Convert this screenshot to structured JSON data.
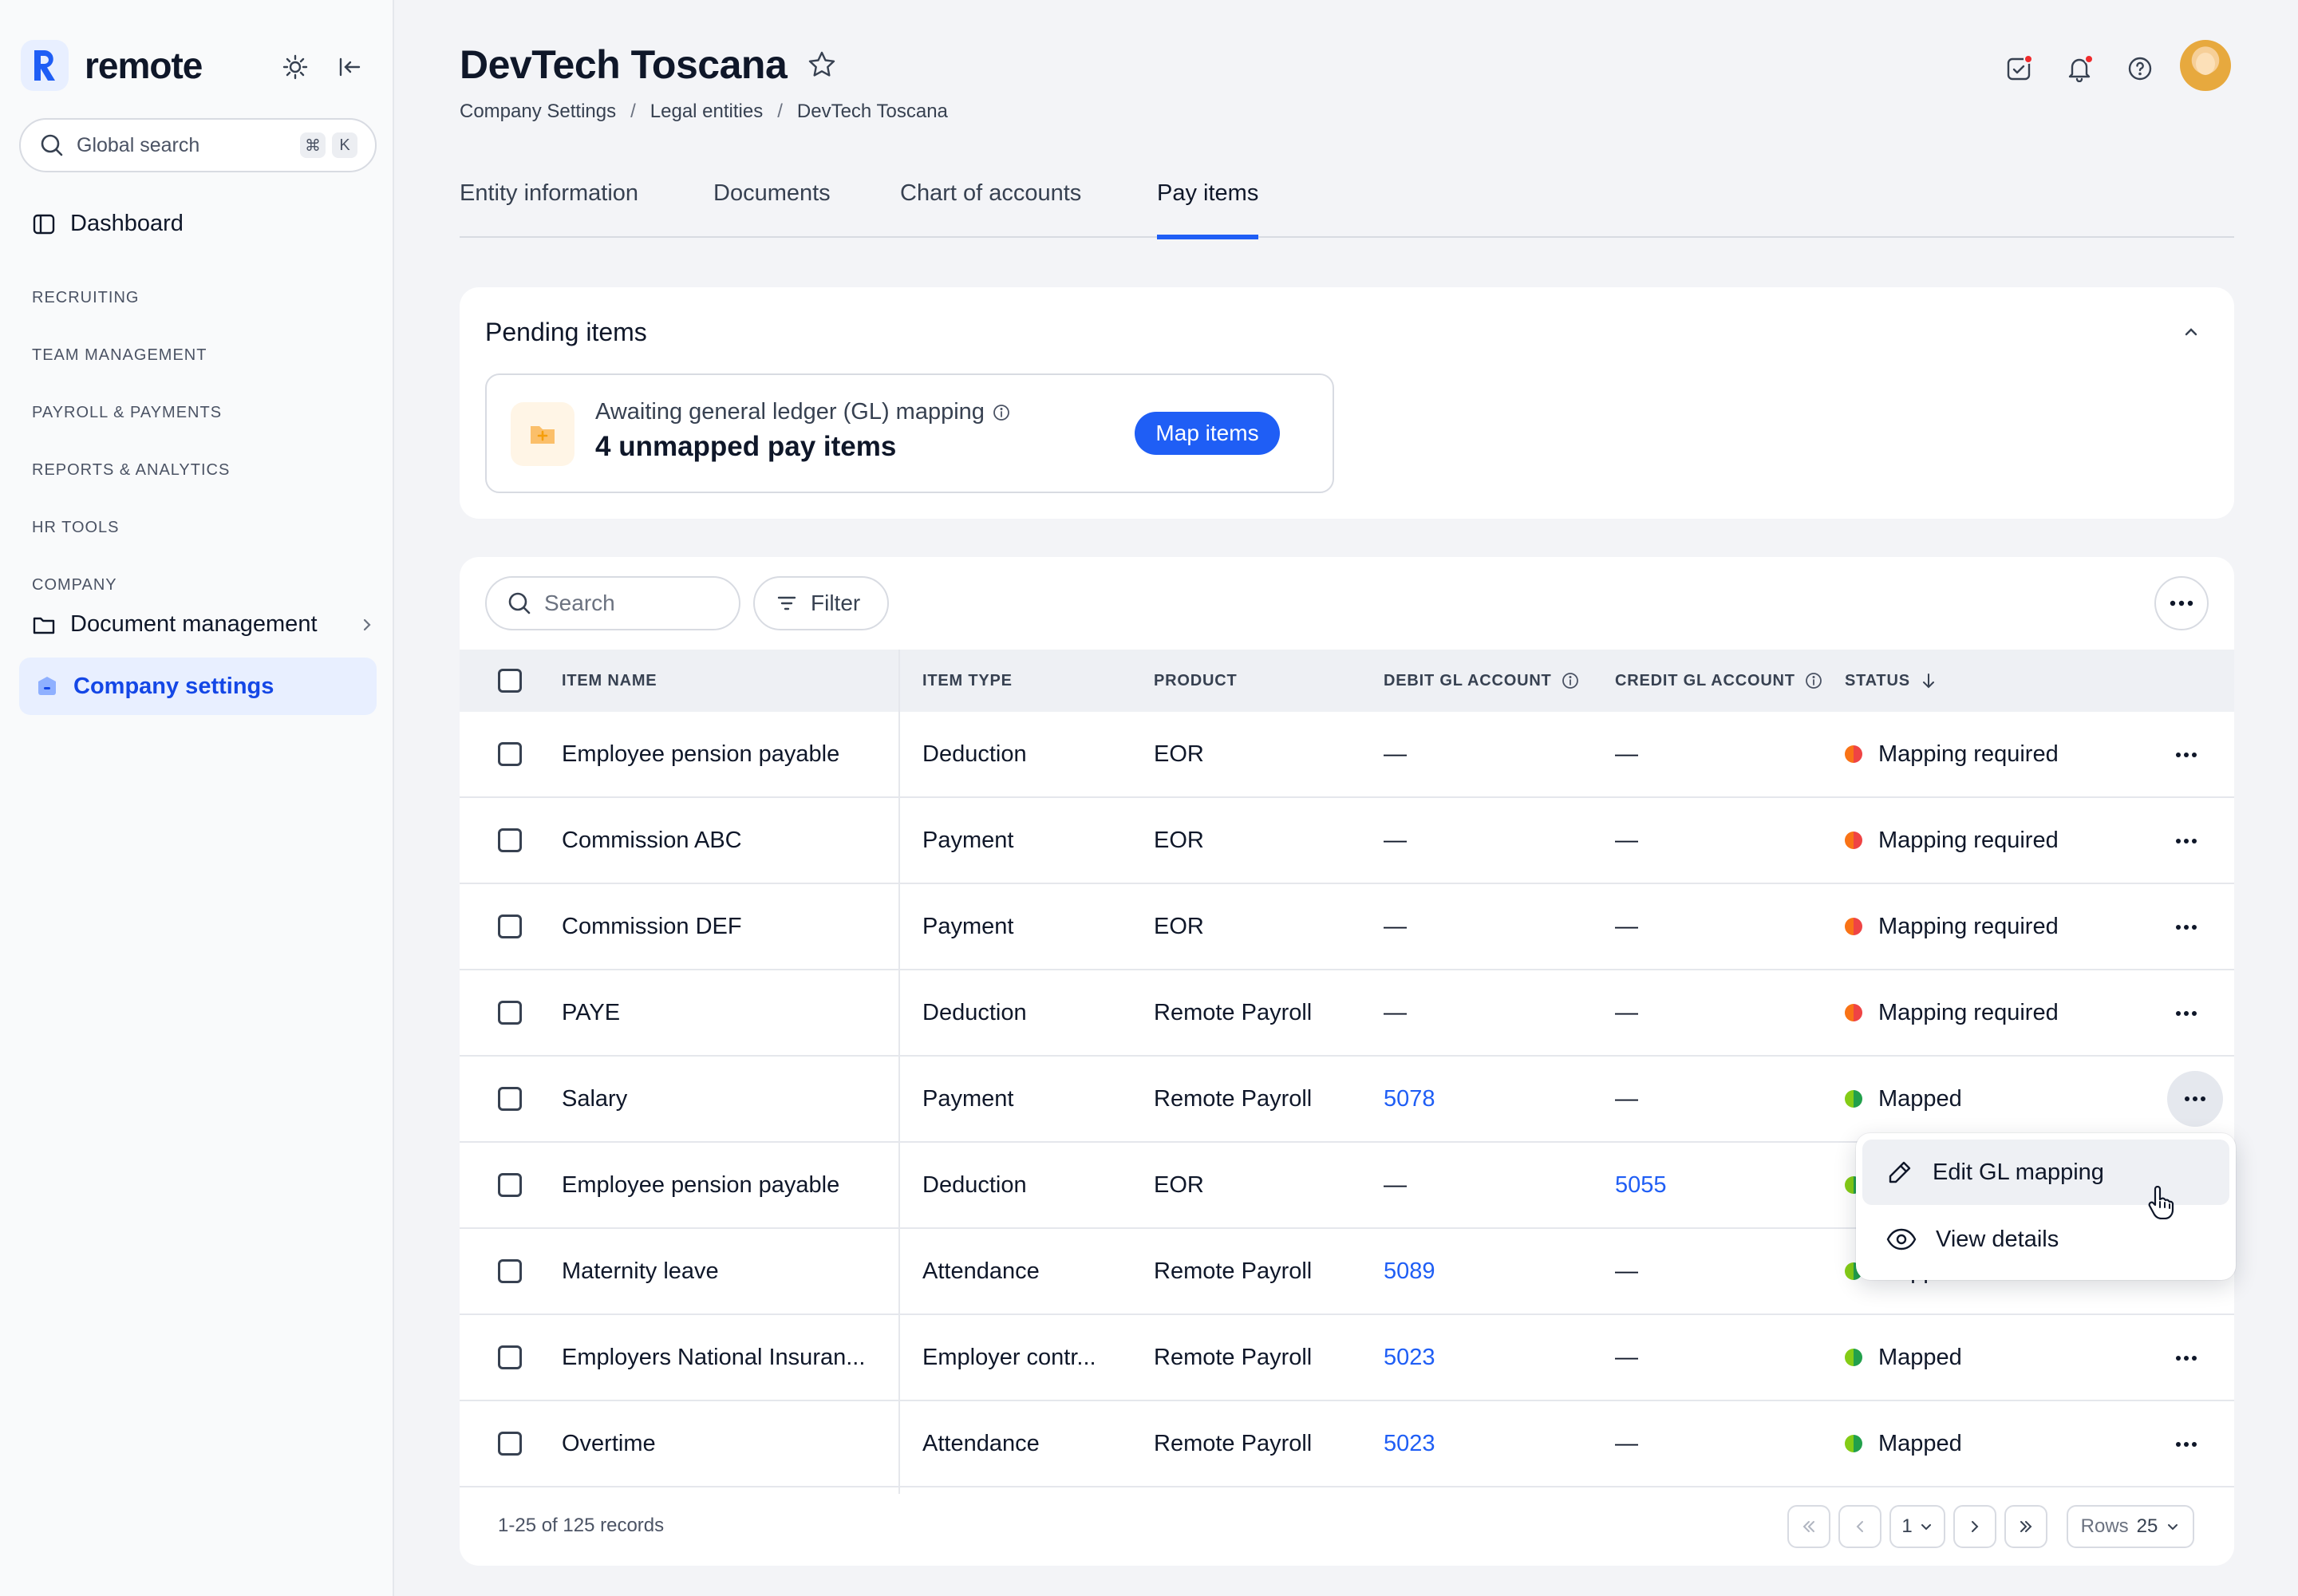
{
  "sidebar": {
    "logo": "remote",
    "search_placeholder": "Global search",
    "search_kbd": [
      "⌘",
      "K"
    ],
    "dashboard": "Dashboard",
    "sections": [
      "RECRUITING",
      "TEAM MANAGEMENT",
      "PAYROLL & PAYMENTS",
      "REPORTS & ANALYTICS",
      "HR TOOLS",
      "COMPANY"
    ],
    "document_management": "Document management",
    "company_settings": "Company settings"
  },
  "header": {
    "title": "DevTech Toscana",
    "breadcrumb": [
      "Company Settings",
      "Legal entities",
      "DevTech Toscana"
    ],
    "tabs": [
      "Entity information",
      "Documents",
      "Chart of accounts",
      "Pay items"
    ],
    "active_tab": "Pay items"
  },
  "pending": {
    "title": "Pending items",
    "label": "Awaiting general ledger (GL) mapping",
    "count_text": "4 unmapped pay items",
    "button": "Map items"
  },
  "table": {
    "search_placeholder": "Search",
    "filter": "Filter",
    "columns": [
      "ITEM NAME",
      "ITEM TYPE",
      "PRODUCT",
      "DEBIT GL ACCOUNT",
      "CREDIT GL ACCOUNT",
      "STATUS"
    ],
    "rows": [
      {
        "name": "Employee pension payable",
        "type": "Deduction",
        "product": "EOR",
        "debit": "—",
        "credit": "—",
        "status": "Mapping required"
      },
      {
        "name": "Commission ABC",
        "type": "Payment",
        "product": "EOR",
        "debit": "—",
        "credit": "—",
        "status": "Mapping required"
      },
      {
        "name": "Commission DEF",
        "type": "Payment",
        "product": "EOR",
        "debit": "—",
        "credit": "—",
        "status": "Mapping required"
      },
      {
        "name": "PAYE",
        "type": "Deduction",
        "product": "Remote Payroll",
        "debit": "—",
        "credit": "—",
        "status": "Mapping required"
      },
      {
        "name": "Salary",
        "type": "Payment",
        "product": "Remote Payroll",
        "debit": "5078",
        "credit": "—",
        "status": "Mapped"
      },
      {
        "name": "Employee pension payable",
        "type": "Deduction",
        "product": "EOR",
        "debit": "—",
        "credit": "5055",
        "status": "Mapped"
      },
      {
        "name": "Maternity leave",
        "type": "Attendance",
        "product": "Remote Payroll",
        "debit": "5089",
        "credit": "—",
        "status": "Mapped"
      },
      {
        "name": "Employers National Insuran...",
        "type": "Employer contr...",
        "product": "Remote Payroll",
        "debit": "5023",
        "credit": "—",
        "status": "Mapped"
      },
      {
        "name": "Overtime",
        "type": "Attendance",
        "product": "Remote Payroll",
        "debit": "5023",
        "credit": "—",
        "status": "Mapped"
      }
    ],
    "records_text": "1-25 of 125 records",
    "page": "1",
    "rows_label": "Rows",
    "rows_value": "25"
  },
  "row_menu": {
    "items": [
      "Edit GL mapping",
      "View details"
    ]
  },
  "colors": {
    "accent": "#1f5ef5",
    "mapping_required": "#f97316",
    "mapped": "#84cc16"
  }
}
